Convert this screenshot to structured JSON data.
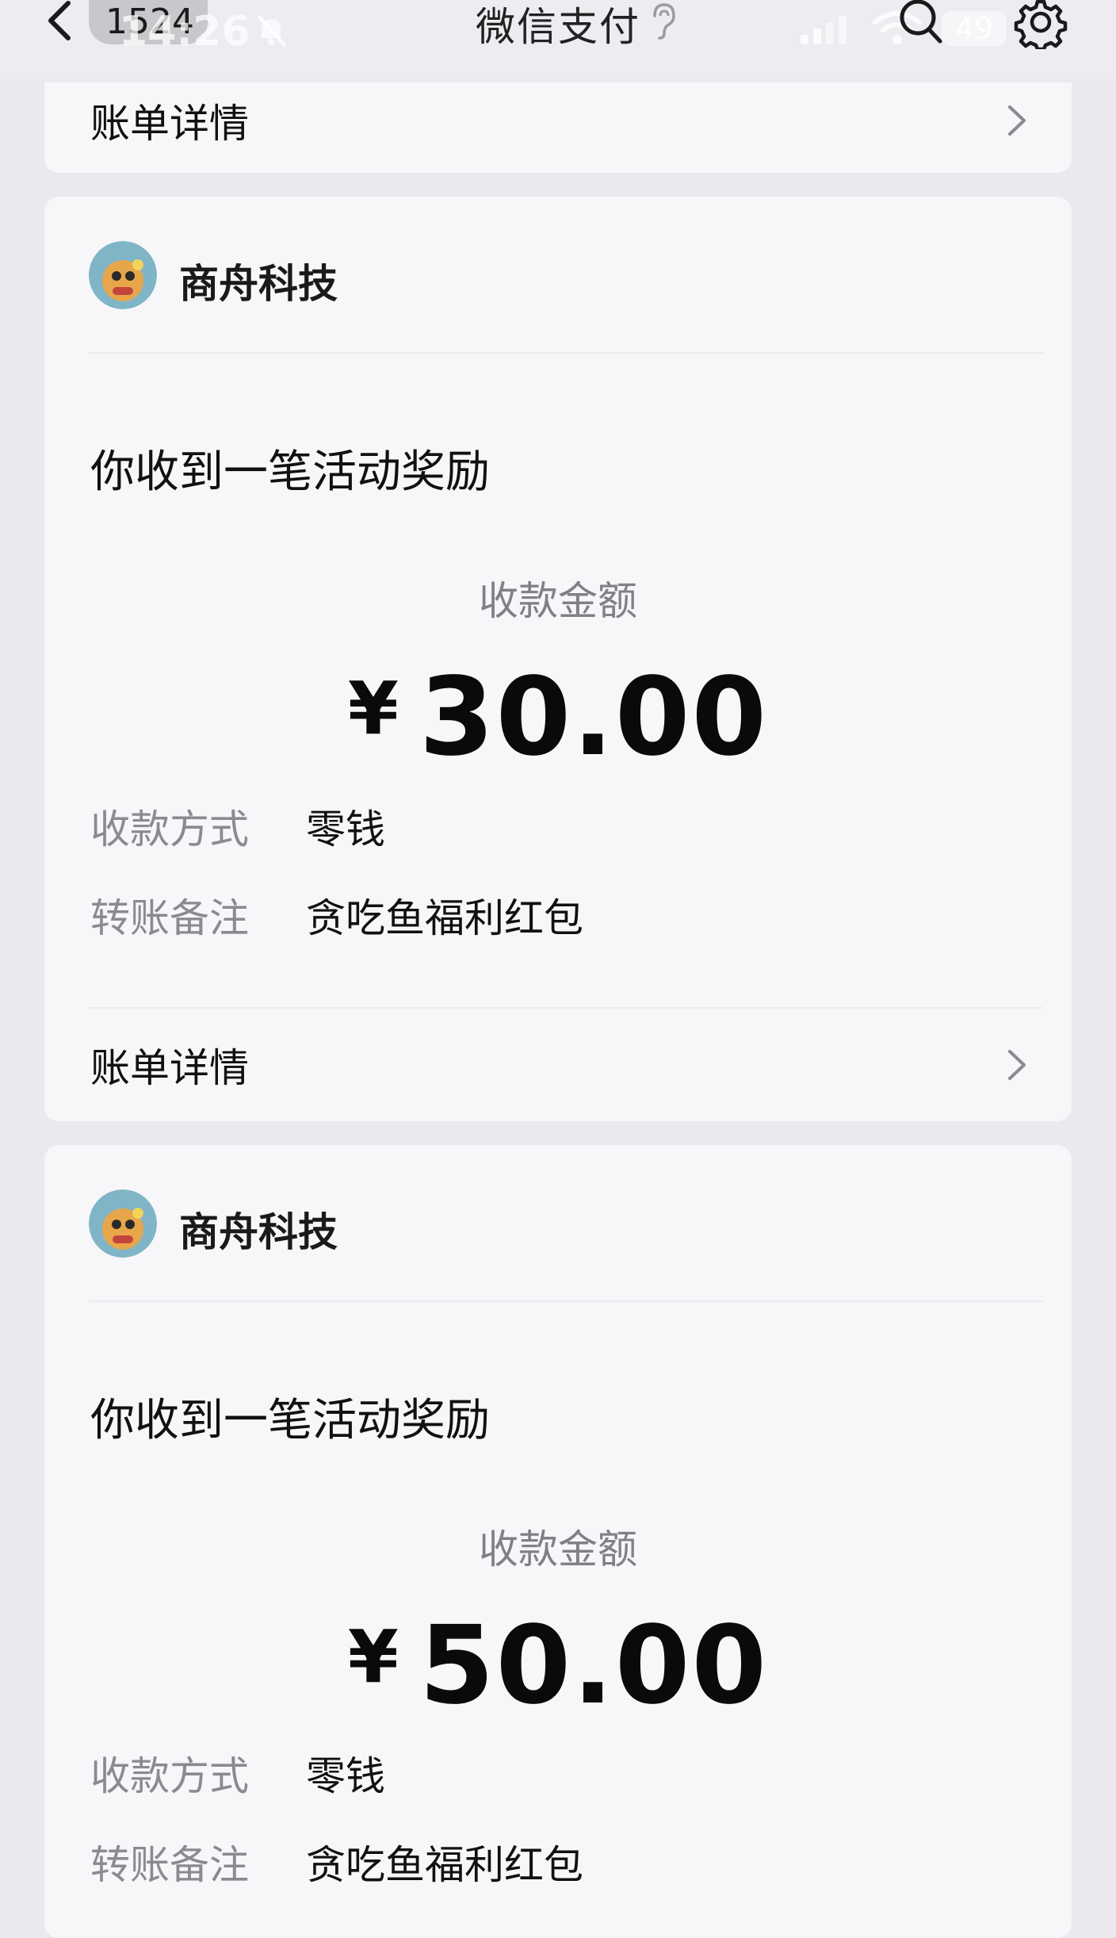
{
  "status_bar": {
    "unread_count": "1524",
    "time": "14:26",
    "battery": "49"
  },
  "header": {
    "title": "微信支付"
  },
  "top_partial_card": {
    "detail_label": "账单详情"
  },
  "cards": [
    {
      "merchant_name": "商舟科技",
      "headline": "你收到一笔活动奖励",
      "amount_label": "收款金额",
      "currency_symbol": "¥",
      "amount_value": "30.00",
      "method_key": "收款方式",
      "method_value": "零钱",
      "note_key": "转账备注",
      "note_value": "贪吃鱼福利红包",
      "detail_label": "账单详情"
    },
    {
      "merchant_name": "商舟科技",
      "headline": "你收到一笔活动奖励",
      "amount_label": "收款金额",
      "currency_symbol": "¥",
      "amount_value": "50.00",
      "method_key": "收款方式",
      "method_value": "零钱",
      "note_key": "转账备注",
      "note_value": "贪吃鱼福利红包"
    }
  ],
  "icons": [
    "back-chevron-icon",
    "bell-muted-icon",
    "ear-icon",
    "signal-icon",
    "wifi-icon",
    "search-icon",
    "gear-icon",
    "chevron-right-icon",
    "merchant-avatar"
  ],
  "colors": {
    "page_bg": "#e9e9ee",
    "card_bg": "#f7f7f9",
    "secondary_text": "#8a8a8f"
  }
}
